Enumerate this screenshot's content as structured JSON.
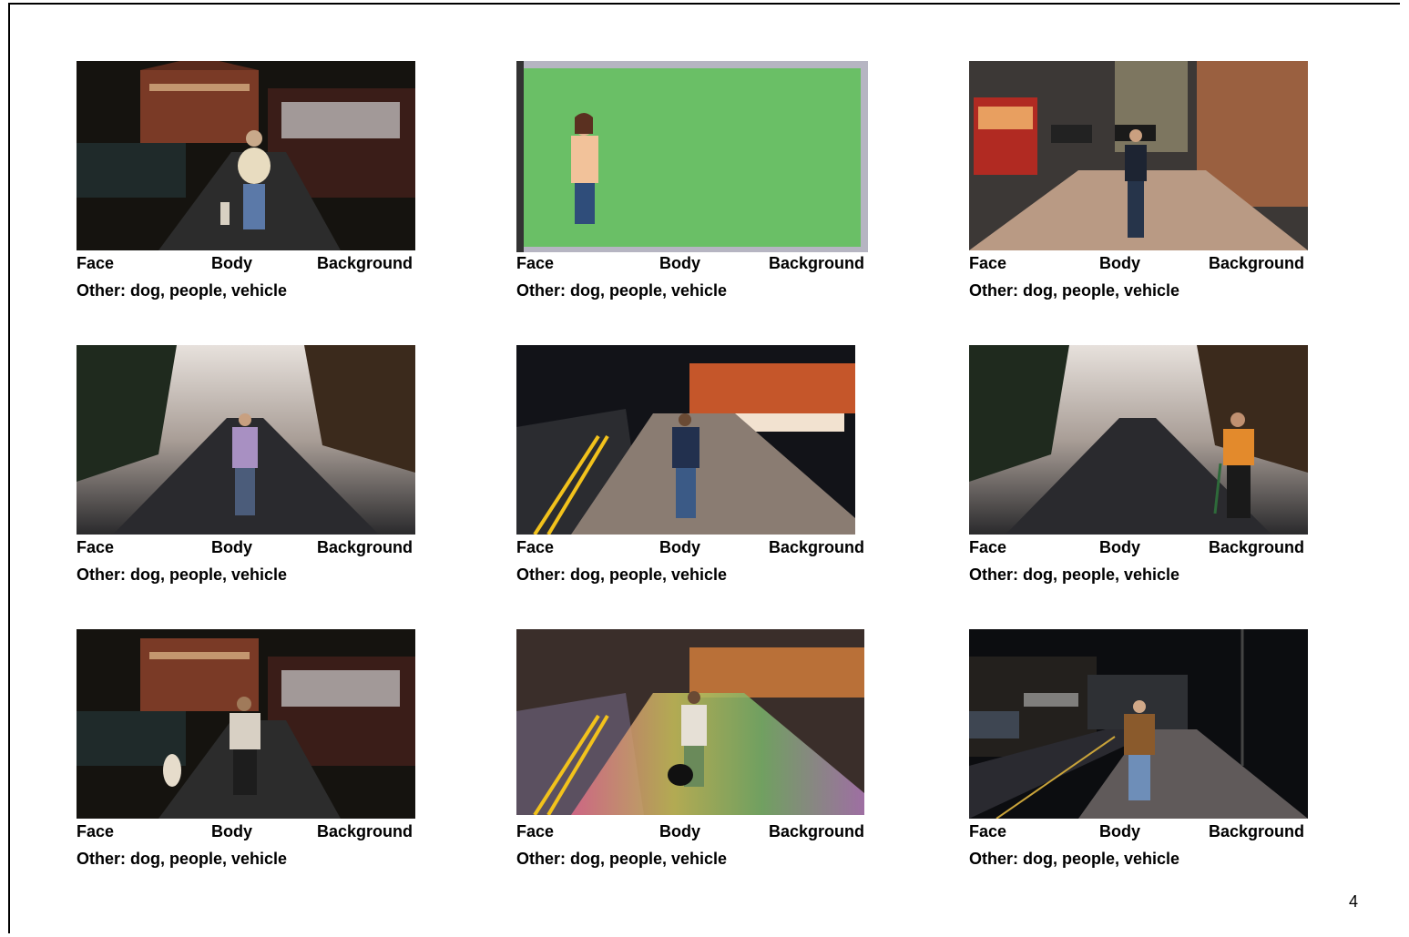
{
  "panels": [
    {
      "face": "Face",
      "body": "Body",
      "background": "Background",
      "other": "Other: dog, people, vehicle",
      "scene": "night-brick-street-with-dog"
    },
    {
      "face": "Face",
      "body": "Body",
      "background": "Background",
      "other": "Other: dog, people, vehicle",
      "scene": "green-screen-studio"
    },
    {
      "face": "Face",
      "body": "Body",
      "background": "Background",
      "other": "Other: dog, people, vehicle",
      "scene": "city-street-with-tram"
    },
    {
      "face": "Face",
      "body": "Body",
      "background": "Background",
      "other": "Other: dog, people, vehicle",
      "scene": "misty-tree-lined-road"
    },
    {
      "face": "Face",
      "body": "Body",
      "background": "Background",
      "other": "Other: dog, people, vehicle",
      "scene": "night-sidewalk-double-yellow-lines"
    },
    {
      "face": "Face",
      "body": "Body",
      "background": "Background",
      "other": "Other: dog, people, vehicle",
      "scene": "misty-road-man-with-cane"
    },
    {
      "face": "Face",
      "body": "Body",
      "background": "Background",
      "other": "Other: dog, people, vehicle",
      "scene": "night-brick-street-man-with-dog"
    },
    {
      "face": "Face",
      "body": "Body",
      "background": "Background",
      "other": "Other: dog, people, vehicle",
      "scene": "rainbow-tinted-night-sidewalk"
    },
    {
      "face": "Face",
      "body": "Body",
      "background": "Background",
      "other": "Other: dog, people, vehicle",
      "scene": "dark-street-person-brown-coat"
    }
  ],
  "page_number": "4"
}
